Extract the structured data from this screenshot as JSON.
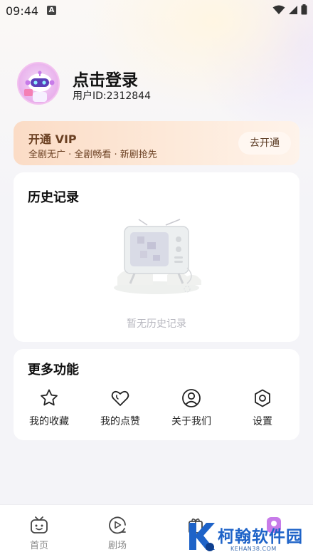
{
  "status_bar": {
    "time": "09:44",
    "notification_icon_label": "A"
  },
  "profile": {
    "title": "点击登录",
    "user_id": "用户ID:2312844"
  },
  "vip": {
    "title": "开通 VIP",
    "subtitle": "全剧无广 · 全剧畅看 · 新剧抢先",
    "button": "去开通"
  },
  "history": {
    "title": "历史记录",
    "empty_text": "暂无历史记录"
  },
  "more": {
    "title": "更多功能",
    "items": [
      {
        "label": "我的收藏",
        "icon": "star-icon"
      },
      {
        "label": "我的点赞",
        "icon": "heart-icon"
      },
      {
        "label": "关于我们",
        "icon": "user-circle-icon"
      },
      {
        "label": "设置",
        "icon": "settings-hex-icon"
      }
    ]
  },
  "bottom_nav": {
    "items": [
      {
        "label": "首页",
        "icon": "tv-icon"
      },
      {
        "label": "剧场",
        "icon": "play-circle-icon"
      },
      {
        "label": "",
        "icon": "gift-icon"
      },
      {
        "label": "",
        "icon": "profile-icon"
      }
    ]
  },
  "watermark": {
    "text": "柯翰软件园",
    "url": "KEHAN38.COM"
  },
  "colors": {
    "vip_text": "#6a3f21",
    "watermark_blue": "#1e63c8",
    "accent_purple": "#c77be9"
  }
}
